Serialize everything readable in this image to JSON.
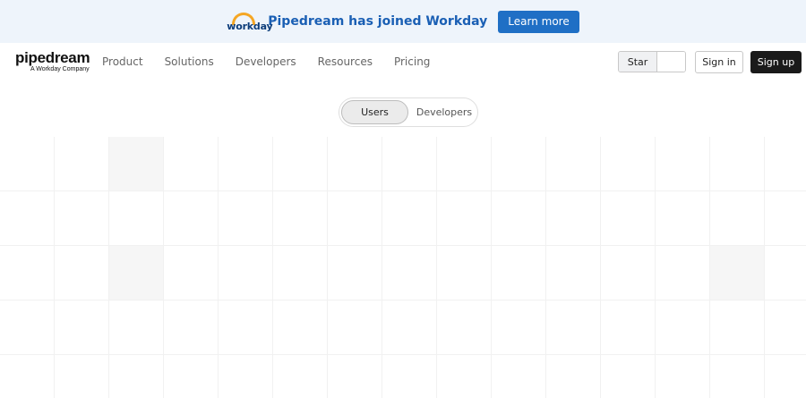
{
  "banner": {
    "logo_text": "workday",
    "message": "Pipedream has joined Workday",
    "cta_label": "Learn more"
  },
  "nav": {
    "brand_name": "pipedream",
    "brand_sub": "A Workday Company",
    "links": [
      "Product",
      "Solutions",
      "Developers",
      "Resources",
      "Pricing"
    ],
    "star_label": "Star",
    "signin_label": "Sign in",
    "signup_label": "Sign up"
  },
  "toggle": {
    "options": [
      "Users",
      "Developers"
    ],
    "selected": "Users"
  },
  "colors": {
    "banner_bg": "#eef4fb",
    "banner_text": "#1a5fb4",
    "cta_bg": "#1f6fc5",
    "signup_bg": "#1a1a1a",
    "workday_arc": "#f5a623"
  }
}
